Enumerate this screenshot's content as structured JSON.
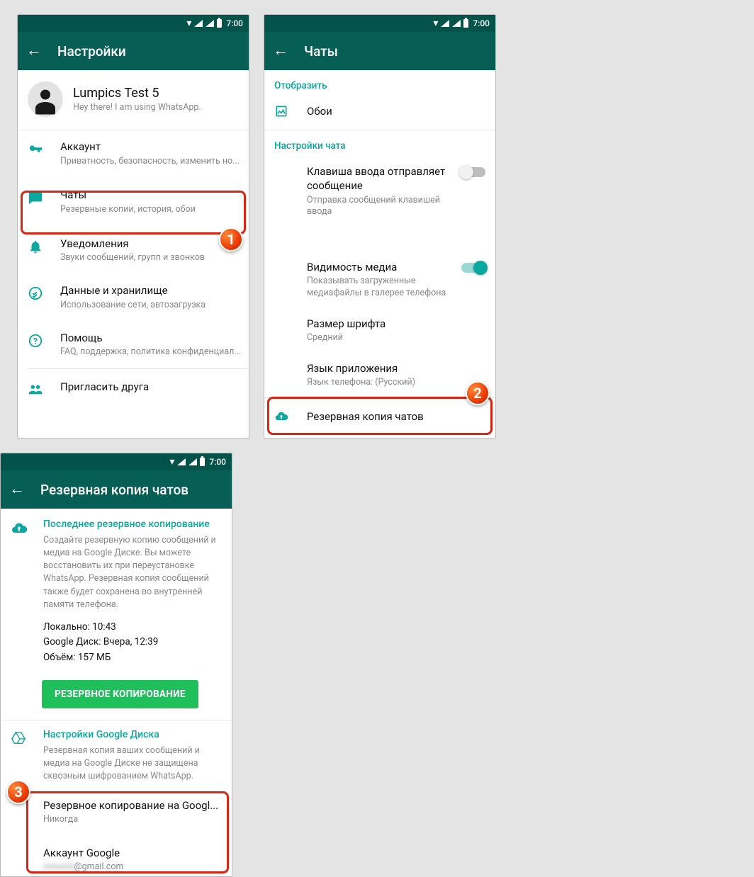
{
  "status": {
    "time": "7:00"
  },
  "screen1": {
    "title": "Настройки",
    "profile": {
      "name": "Lumpics Test 5",
      "status": "Hey there! I am using WhatsApp."
    },
    "items": {
      "account": {
        "title": "Аккаунт",
        "sub": "Приватность, безопасность, изменить но..."
      },
      "chats": {
        "title": "Чаты",
        "sub": "Резервные копии, история, обои"
      },
      "notif": {
        "title": "Уведомления",
        "sub": "Звуки сообщений, групп и звонков"
      },
      "data": {
        "title": "Данные и хранилище",
        "sub": "Использование сети, автозагрузка"
      },
      "help": {
        "title": "Помощь",
        "sub": "FAQ, поддержка, политика конфиденциал..."
      },
      "invite": {
        "title": "Пригласить друга"
      }
    }
  },
  "screen2": {
    "title": "Чаты",
    "display_section": "Отобразить",
    "wallpaper": "Обои",
    "chat_settings_section": "Настройки чата",
    "enter_send": {
      "title": "Клавиша ввода отправляет сообщение",
      "sub": "Отправка сообщений клавишей ввода"
    },
    "media_vis": {
      "title": "Видимость медиа",
      "sub": "Показывать загруженные медиафайлы в галерее телефона"
    },
    "font_size": {
      "title": "Размер шрифта",
      "sub": "Средний"
    },
    "app_lang": {
      "title": "Язык приложения",
      "sub": "Язык телефона: (Русский)"
    },
    "backup": {
      "title": "Резервная копия чатов"
    }
  },
  "screen3": {
    "title": "Резервная копия чатов",
    "last_backup_hdr": "Последнее резервное копирование",
    "last_backup_desc": "Создайте резервную копию сообщений и медиа на Google Диске. Вы можете восстановить их при переустановке WhatsApp. Резервная копия сообщений также будет сохранена во внутренней памяти телефона.",
    "local": "Локально: 10:43",
    "gdrive": "Google Диск: Вчера, 12:39",
    "size": "Объём: 157 МБ",
    "backup_btn": "РЕЗЕРВНОЕ КОПИРОВАНИЕ",
    "gdrive_settings_hdr": "Настройки Google Диска",
    "gdrive_settings_desc": "Резервная копия ваших сообщений и медиа на Google Диске не защищена сквозным шифрованием WhatsApp.",
    "backup_to_google": {
      "title": "Резервное копирование на Googl...",
      "sub": "Никогда"
    },
    "google_account": {
      "title": "Аккаунт Google",
      "sub_blur": "xxxxxxx",
      "sub_domain": "@gmail.com"
    }
  }
}
